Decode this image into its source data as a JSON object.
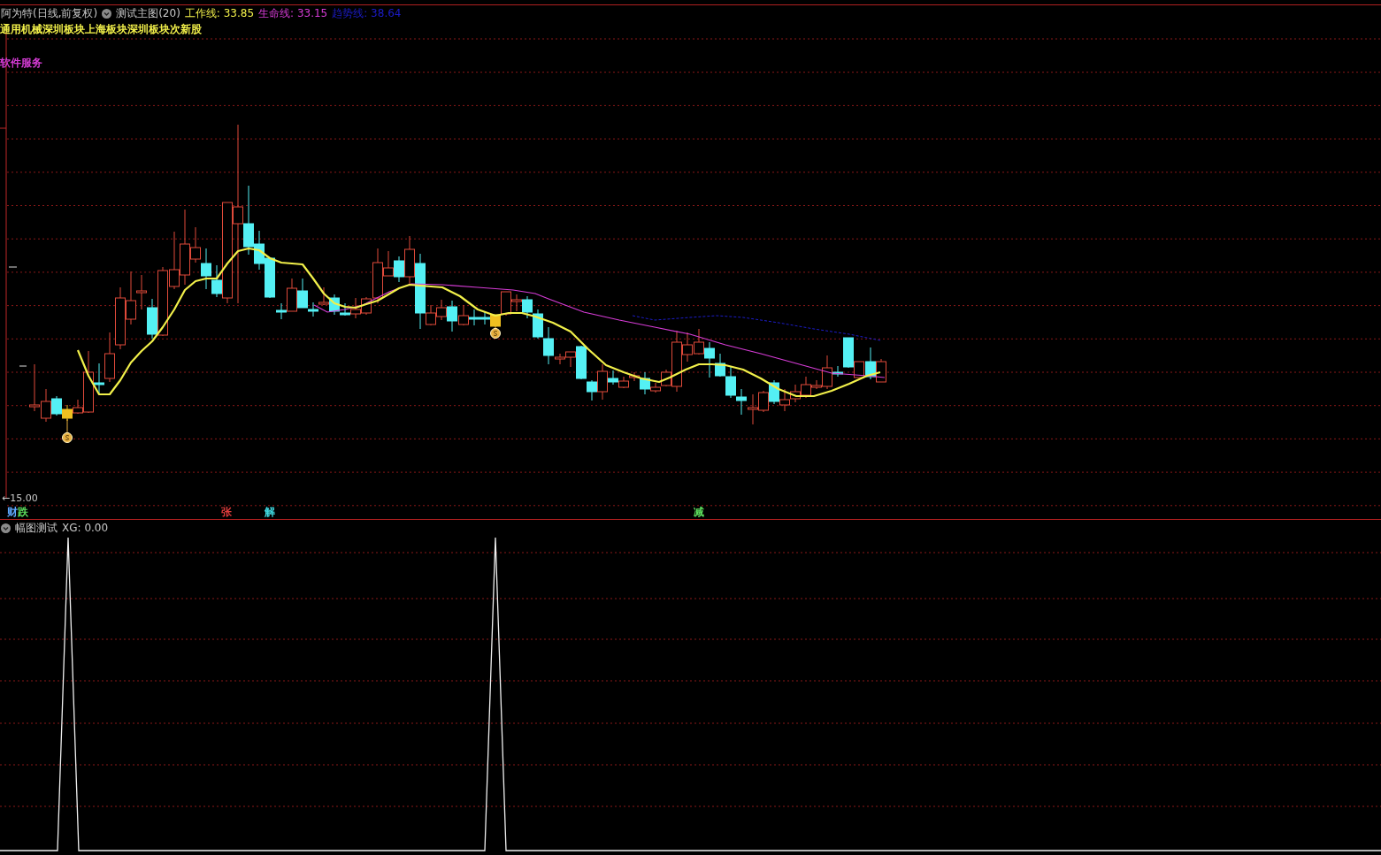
{
  "header": {
    "stock": "阿为特(日线,前复权)",
    "indicator": "测试主图(20)",
    "lines": [
      {
        "label": "工作线: 33.85",
        "color": "#f2f04a"
      },
      {
        "label": "生命线: 33.15",
        "color": "#d63cd6"
      },
      {
        "label": "趋势线: 38.64",
        "color": "#1c1cc8"
      }
    ]
  },
  "sectors": [
    {
      "text": "通用机械深圳板块上海板块深圳板块次新股",
      "color": "#f2f04a"
    },
    {
      "text": "软件服务",
      "color": "#d63cd6"
    }
  ],
  "axis_label": "←15.00",
  "signals": [
    {
      "text": "财",
      "color": "#5fa8ff"
    },
    {
      "text": "跌",
      "color": "#5ee05e"
    },
    {
      "text": "张",
      "color": "#e03c3c"
    },
    {
      "text": "解",
      "color": "#40d8e0"
    },
    {
      "text": "减",
      "color": "#5ee05e"
    }
  ],
  "subpanel": {
    "title": "幅图测试",
    "reading": "XG: 0.00"
  }
}
